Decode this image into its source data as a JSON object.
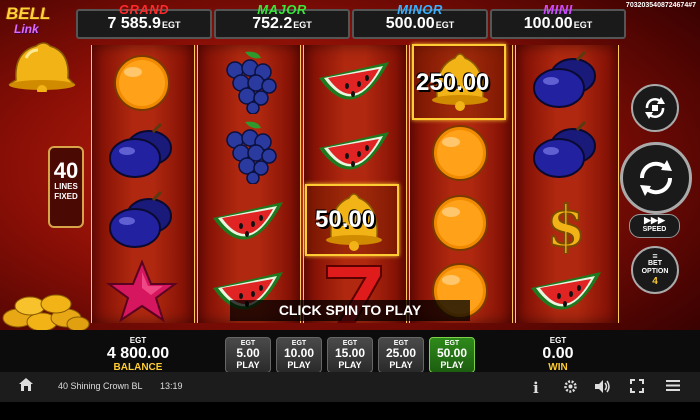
{
  "game_id": "7032035408724674#7",
  "logo": {
    "line1": "BELL",
    "line2": "Link"
  },
  "jackpots": [
    {
      "label": "GRAND",
      "value": "7 585.9",
      "suffix": "EGT",
      "color": "#ff2a2a"
    },
    {
      "label": "MAJOR",
      "value": "752.2",
      "suffix": "EGT",
      "color": "#39e639"
    },
    {
      "label": "MINOR",
      "value": "500.00",
      "suffix": "EGT",
      "color": "#3ab0ff"
    },
    {
      "label": "MINI",
      "value": "100.00",
      "suffix": "EGT",
      "color": "#d04aff"
    }
  ],
  "lines": {
    "count": "40",
    "line1": "LINES",
    "line2": "FIXED"
  },
  "reels": [
    [
      "orange",
      "plum",
      "plum",
      "star"
    ],
    [
      "grapes",
      "grapes",
      "watermelon",
      "watermelon"
    ],
    [
      "watermelon",
      "watermelon",
      "bell",
      "seven"
    ],
    [
      "bell",
      "orange",
      "orange",
      "orange"
    ],
    [
      "plum",
      "plum",
      "dollar",
      "watermelon"
    ]
  ],
  "bell_values": {
    "reel3": "50.00",
    "reel4": "250.00"
  },
  "message": "CLICK SPIN TO PLAY",
  "controls": {
    "speed_label": "SPEED",
    "bet_option_label1": "BET",
    "bet_option_label2": "OPTION",
    "bet_option_value": "4"
  },
  "balance": {
    "currency": "EGT",
    "value": "4 800.00",
    "label": "BALANCE"
  },
  "win": {
    "currency": "EGT",
    "value": "0.00",
    "label": "WIN"
  },
  "bets": [
    {
      "currency": "EGT",
      "value": "5.00",
      "label": "PLAY",
      "active": false
    },
    {
      "currency": "EGT",
      "value": "10.00",
      "label": "PLAY",
      "active": false
    },
    {
      "currency": "EGT",
      "value": "15.00",
      "label": "PLAY",
      "active": false
    },
    {
      "currency": "EGT",
      "value": "25.00",
      "label": "PLAY",
      "active": false
    },
    {
      "currency": "EGT",
      "value": "50.00",
      "label": "PLAY",
      "active": true
    }
  ],
  "footer": {
    "game_name": "40 Shining Crown BL",
    "time": "13:19"
  },
  "icons": [
    "home-icon",
    "info-icon",
    "settings-icon",
    "sound-icon",
    "fullscreen-icon",
    "menu-icon"
  ]
}
